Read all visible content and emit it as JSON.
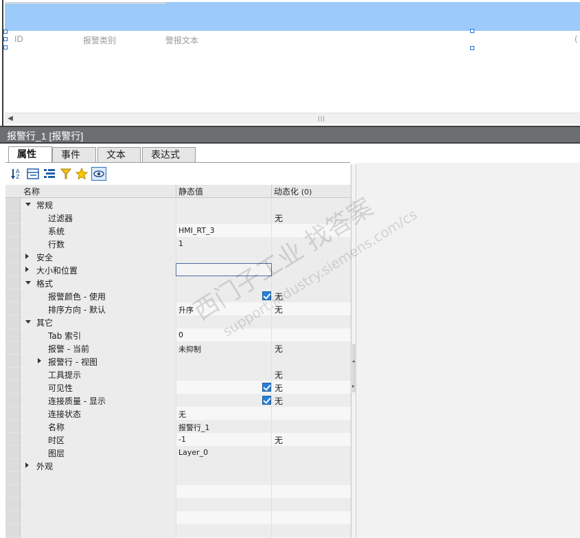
{
  "canvas": {
    "alarm_columns": [
      "ID",
      "报警类别",
      "警报文本"
    ]
  },
  "inspector": {
    "title": "报警行_1 [报警行]",
    "tabs": [
      {
        "label": "属性",
        "active": true
      },
      {
        "label": "事件",
        "active": false
      },
      {
        "label": "文本",
        "active": false
      },
      {
        "label": "表达式",
        "active": false
      }
    ],
    "toolbar_icons": [
      "sort-az-icon",
      "collapse-all-icon",
      "expand-all-icon",
      "filter-icon",
      "favorite-star-icon",
      "eye-icon"
    ],
    "grid": {
      "headers": {
        "name": "名称",
        "static": "静态值",
        "dynamic": "动态化",
        "dynamic_count": "(0)"
      },
      "rows": [
        {
          "type": "group",
          "expanded": true,
          "level": 0,
          "name": "常规",
          "value": "",
          "dynamic": ""
        },
        {
          "type": "leaf",
          "level": 1,
          "name": "过滤器",
          "value": "",
          "dynamic": "无"
        },
        {
          "type": "leaf",
          "level": 1,
          "name": "系统",
          "value": "HMI_RT_3",
          "dynamic": ""
        },
        {
          "type": "leaf",
          "level": 1,
          "name": "行数",
          "value": "1",
          "dynamic": ""
        },
        {
          "type": "group",
          "expanded": false,
          "level": 0,
          "name": "安全",
          "value": "",
          "dynamic": ""
        },
        {
          "type": "group",
          "expanded": false,
          "level": 0,
          "name": "大小和位置",
          "value": "",
          "dynamic": "",
          "selected": true
        },
        {
          "type": "group",
          "expanded": true,
          "level": 0,
          "name": "格式",
          "value": "",
          "dynamic": ""
        },
        {
          "type": "leaf",
          "level": 1,
          "name": "报警颜色 - 使用",
          "value": "",
          "checkbox": true,
          "dynamic": "无"
        },
        {
          "type": "leaf",
          "level": 1,
          "name": "排序方向 - 默认",
          "value": "升序",
          "dynamic": "无"
        },
        {
          "type": "group",
          "expanded": true,
          "level": 0,
          "name": "其它",
          "value": "",
          "dynamic": ""
        },
        {
          "type": "leaf",
          "level": 1,
          "name": "Tab 索引",
          "value": "0",
          "dynamic": ""
        },
        {
          "type": "leaf",
          "level": 1,
          "name": "报警 - 当前",
          "value": "未抑制",
          "dynamic": "无"
        },
        {
          "type": "group",
          "expanded": false,
          "level": 1,
          "name": "报警行 - 视图",
          "value": "",
          "dynamic": ""
        },
        {
          "type": "leaf",
          "level": 1,
          "name": "工具提示",
          "value": "",
          "dynamic": "无"
        },
        {
          "type": "leaf",
          "level": 1,
          "name": "可见性",
          "value": "",
          "checkbox": true,
          "dynamic": "无"
        },
        {
          "type": "leaf",
          "level": 1,
          "name": "连接质量 - 显示",
          "value": "",
          "checkbox": true,
          "dynamic": "无"
        },
        {
          "type": "leaf",
          "level": 1,
          "name": "连接状态",
          "value": "无",
          "dynamic": ""
        },
        {
          "type": "leaf",
          "level": 1,
          "name": "名称",
          "value": "报警行_1",
          "dynamic": ""
        },
        {
          "type": "leaf",
          "level": 1,
          "name": "时区",
          "value": "-1",
          "dynamic": "无"
        },
        {
          "type": "leaf",
          "level": 1,
          "name": "图层",
          "value": "Layer_0",
          "dynamic": ""
        },
        {
          "type": "group",
          "expanded": false,
          "level": 0,
          "name": "外观",
          "value": "",
          "dynamic": ""
        }
      ]
    }
  },
  "watermark": {
    "line1": "西门子工业 找答案",
    "line2": "support.industry.siemens.com/cs"
  },
  "colors": {
    "alarm_header": "#9ccbfb",
    "title_bar": "#6c6f72",
    "checkbox": "#2a7fd4",
    "selection_border": "#4a6c9b"
  }
}
